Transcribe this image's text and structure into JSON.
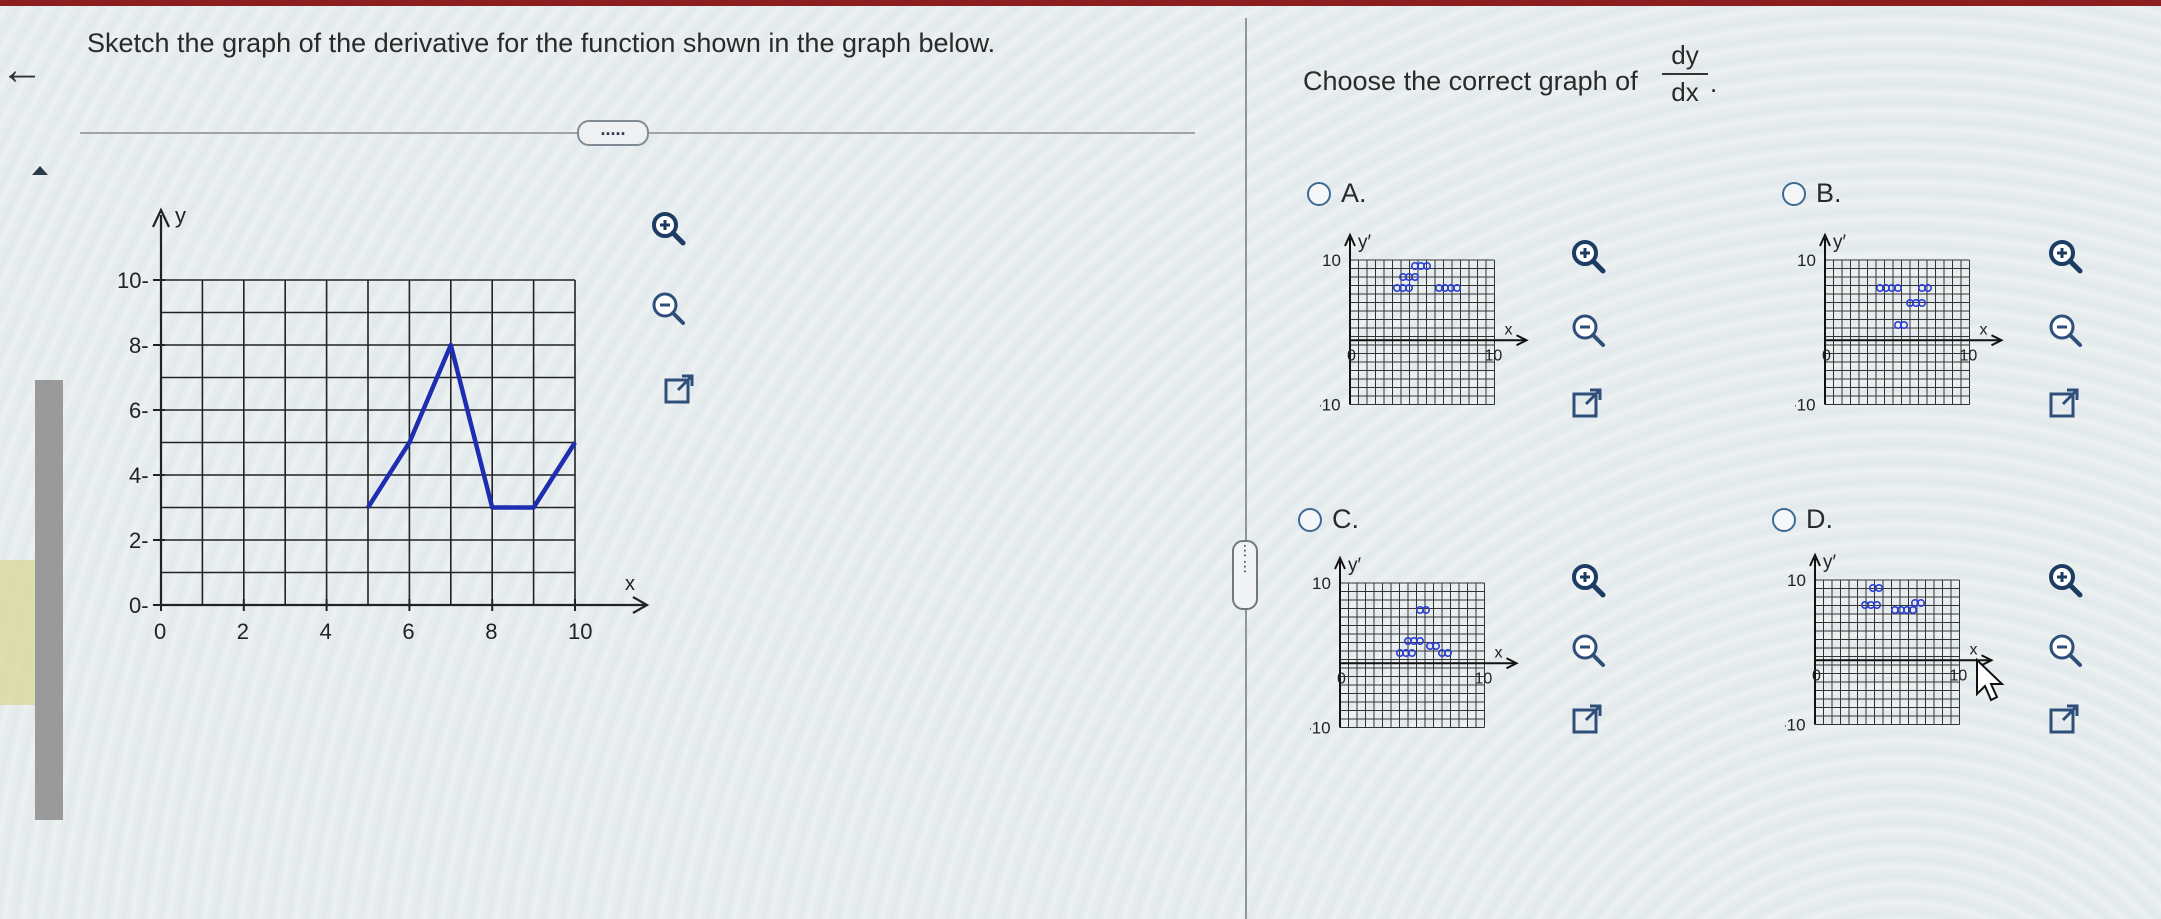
{
  "question": {
    "text": "Sketch the graph of the derivative for the function shown in the graph below.",
    "more_label": "....."
  },
  "answer_prompt": {
    "text": "Choose the correct graph of",
    "fraction_num": "dy",
    "fraction_den": "dx",
    "suffix": "."
  },
  "options": [
    {
      "label": "A."
    },
    {
      "label": "B."
    },
    {
      "label": "C."
    },
    {
      "label": "D."
    }
  ],
  "main_graph": {
    "y_axis_label": "y",
    "x_axis_label": "x",
    "x_ticks": [
      "0",
      "2",
      "4",
      "6",
      "8",
      "10"
    ],
    "y_ticks": [
      "10",
      "8",
      "6",
      "4",
      "2",
      "0"
    ],
    "line_color": "#1f2db0"
  },
  "mini_graph": {
    "y_axis_label": "y′",
    "x_axis_label": "x",
    "y_max_label": "10",
    "y_min_label": "-10",
    "x_max_label": "10",
    "zero_label": "0",
    "point_color": "#2b3fd4"
  },
  "icons": {
    "zoom_in": "zoom-in-icon",
    "zoom_out": "zoom-out-icon",
    "open_external": "open-external-icon"
  },
  "chart_data": [
    {
      "type": "line",
      "title": "",
      "xlabel": "x",
      "ylabel": "y",
      "xlim": [
        0,
        10
      ],
      "ylim": [
        0,
        10
      ],
      "x": [
        5,
        6,
        7,
        8,
        9,
        10
      ],
      "y": [
        3,
        5,
        8,
        3,
        3,
        5
      ],
      "grid": true
    }
  ]
}
